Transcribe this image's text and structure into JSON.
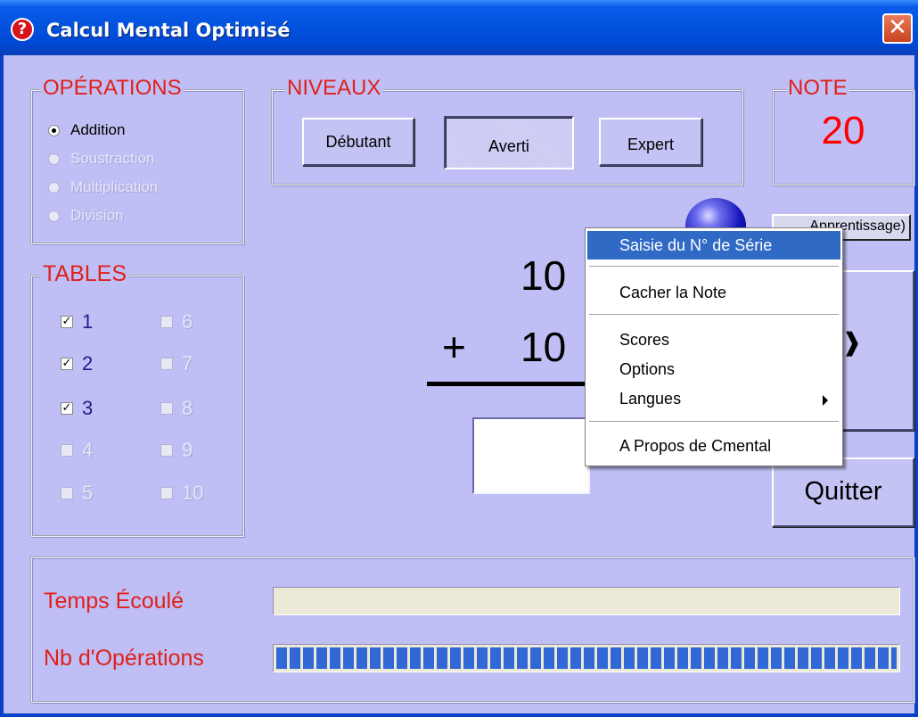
{
  "window": {
    "title": "Calcul Mental Optimisé",
    "close_glyph": "✕"
  },
  "operations": {
    "legend": "OPÉRATIONS",
    "items": [
      {
        "label": "Addition",
        "checked": true,
        "enabled": true
      },
      {
        "label": "Soustraction",
        "checked": false,
        "enabled": false
      },
      {
        "label": "Multiplication",
        "checked": false,
        "enabled": false
      },
      {
        "label": "Division",
        "checked": false,
        "enabled": false
      }
    ]
  },
  "niveaux": {
    "legend": "NIVEAUX",
    "buttons": [
      {
        "label": "Débutant",
        "pressed": false
      },
      {
        "label": "Averti",
        "pressed": true
      },
      {
        "label": "Expert",
        "pressed": false
      }
    ]
  },
  "note": {
    "legend": "NOTE",
    "value": "20",
    "color": "#ff0000"
  },
  "mode_button": {
    "label": "Apprentissage)"
  },
  "tables": {
    "legend": "TABLES",
    "items": [
      {
        "label": "1",
        "checked": true,
        "enabled": true
      },
      {
        "label": "2",
        "checked": true,
        "enabled": true
      },
      {
        "label": "3",
        "checked": true,
        "enabled": true
      },
      {
        "label": "4",
        "checked": false,
        "enabled": false
      },
      {
        "label": "5",
        "checked": false,
        "enabled": false
      },
      {
        "label": "6",
        "checked": false,
        "enabled": false
      },
      {
        "label": "7",
        "checked": false,
        "enabled": false
      },
      {
        "label": "8",
        "checked": false,
        "enabled": false
      },
      {
        "label": "9",
        "checked": false,
        "enabled": false
      },
      {
        "label": "10",
        "checked": false,
        "enabled": false
      }
    ]
  },
  "problem": {
    "operand1": "10",
    "operator": "+",
    "operand2": "10",
    "answer": ""
  },
  "quit_button": {
    "label": "Quitter"
  },
  "stats": {
    "elapsed_label": "Temps Écoulé",
    "elapsed_progress": 0,
    "ops_label": "Nb d'Opérations",
    "ops_progress": 1.0
  },
  "context_menu": {
    "items": [
      {
        "label": "Saisie du N° de Série",
        "highlighted": true
      },
      {
        "label": "Cacher la Note"
      },
      {
        "label": "Scores"
      },
      {
        "label": "Options"
      },
      {
        "label": "Langues",
        "submenu": true
      },
      {
        "label": "A Propos de Cmental"
      }
    ]
  },
  "colors": {
    "background": "#bfbff5",
    "accent_red": "#e0201a",
    "title_blue": "#0353df",
    "menu_highlight": "#316ac5",
    "progress": "#3168d5"
  }
}
